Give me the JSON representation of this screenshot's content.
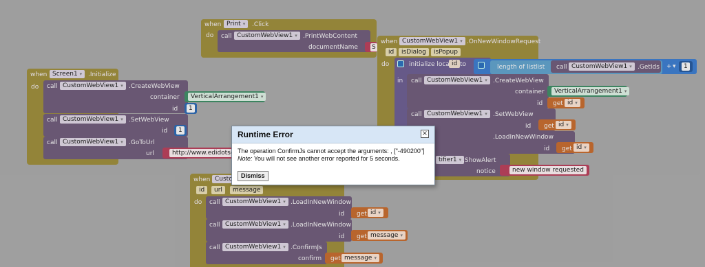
{
  "print_block": {
    "when": "when",
    "component": "Print",
    "event": ".Click",
    "do": "do",
    "call": "call",
    "target": "CustomWebView1",
    "method": ".PrintWebContent",
    "param": "documentName",
    "arg_fragment": "S"
  },
  "window_block": {
    "when": "when",
    "component": "CustomWebView1",
    "event": ".OnNewWindowRequest",
    "params": [
      "id",
      "isDialog",
      "isPopup"
    ],
    "do": "do",
    "init": "initialize local",
    "local_name": "id",
    "to": "to",
    "length": "length of list",
    "list": "list",
    "call": "call",
    "target": "CustomWebView1",
    "getids": ".GetIds",
    "plus": "+",
    "one": "1",
    "in": "in",
    "create": {
      "call": "call",
      "target": "CustomWebView1",
      "method": ".CreateWebView",
      "param": "container",
      "container": "VerticalArrangement1",
      "id": "id",
      "get": "get",
      "get_var": "id"
    },
    "set": {
      "call": "call",
      "target": "CustomWebView1",
      "method": ".SetWebView",
      "id": "id",
      "get": "get",
      "get_var": "id"
    },
    "load": {
      "method": ".LoadInNewWindow",
      "id": "id",
      "get": "get",
      "get_var": "id"
    },
    "alert": {
      "target": "tifier1",
      "method": ".ShowAlert",
      "param": "notice",
      "text": "new window requested"
    }
  },
  "screen_block": {
    "when": "when",
    "component": "Screen1",
    "event": ".Initialize",
    "do": "do",
    "create": {
      "call": "call",
      "target": "CustomWebView1",
      "method": ".CreateWebView",
      "param": "container",
      "container": "VerticalArrangement1",
      "id": "id",
      "value": "1"
    },
    "set": {
      "call": "call",
      "target": "CustomWebView1",
      "method": ".SetWebView",
      "id": "id",
      "value": "1"
    },
    "goto": {
      "call": "call",
      "target": "CustomWebView1",
      "method": ".GoToUrl",
      "url": "url",
      "url_value": "http://www.edidotsche"
    }
  },
  "confirm_block": {
    "when": "when",
    "component": "Custo",
    "params": [
      "id",
      "url",
      "message"
    ],
    "do": "do",
    "load1": {
      "call": "call",
      "target": "CustomWebView1",
      "method": ".LoadInNewWindow",
      "id": "id",
      "get": "get",
      "get_var": "id"
    },
    "load2": {
      "call": "call",
      "target": "CustomWebView1",
      "method": ".LoadInNewWindow",
      "id": "id",
      "get": "get",
      "get_var": "message"
    },
    "confirm": {
      "call": "call",
      "target": "CustomWebView1",
      "method": ".ConfirmJs",
      "param": "confirm",
      "get": "get",
      "get_var": "message"
    }
  },
  "dialog": {
    "title": "Runtime Error",
    "close_glyph": "×",
    "message": "The operation ConfirmJs cannot accept the arguments: , [\"-490200\"]",
    "note_label": "Note:",
    "note_text": " You will not see another error reported for 5 seconds.",
    "dismiss": "Dismiss"
  },
  "colors": {
    "workspace": "#a5a5a5",
    "event": "#9a8a3c",
    "procedure": "#6e5b78",
    "get": "#c06a2f",
    "number": "#2e68ad",
    "string": "#b3405a",
    "component": "#3f8a64"
  }
}
